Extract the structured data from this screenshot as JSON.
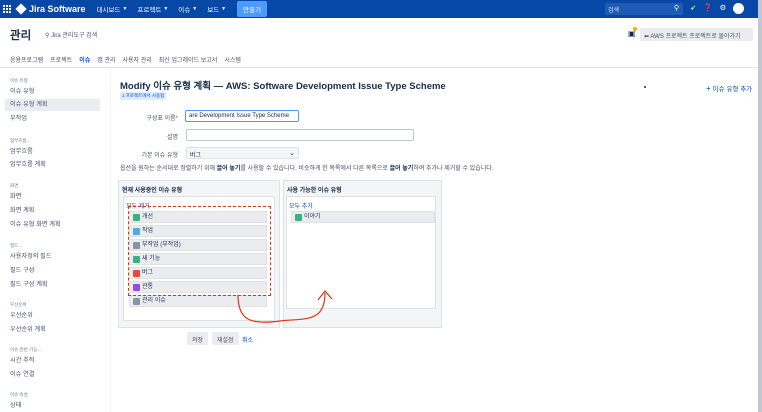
{
  "topnav": {
    "logo_text": "Jira Software",
    "items": [
      "대시보드",
      "프로젝트",
      "이슈",
      "보드"
    ],
    "create_label": "만들기",
    "search_placeholder": "검색"
  },
  "admin": {
    "title": "관리",
    "search_label": "Jira 관리도구 검색",
    "back_to_project": "AWS 프로젝트 프로젝트로 돌아가기",
    "tabs": [
      "응용프로그램",
      "프로젝트",
      "이슈",
      "앱 관리",
      "사용자 관리",
      "최신 업그레이드 보고서",
      "시스템"
    ],
    "active_tab_index": 2
  },
  "sidebar": {
    "sections": [
      {
        "heading": "이슈 유형",
        "items": [
          "이슈 유형",
          "이슈 유형 계획",
          "부작업"
        ]
      },
      {
        "heading": "업무흐름...",
        "items": [
          "업무흐름",
          "업무흐름 계획"
        ]
      },
      {
        "heading": "화면",
        "items": [
          "화면",
          "화면 계획",
          "이슈 유형 화면 계획"
        ]
      },
      {
        "heading": "필드...",
        "items": [
          "사용자정의 필드",
          "필드 구성",
          "필드 구성 계획"
        ]
      },
      {
        "heading": "우선순위",
        "items": [
          "우선순위",
          "우선순위 계획"
        ]
      },
      {
        "heading": "이슈 관련 기능...",
        "items": [
          "시간 추적",
          "이슈 연결"
        ]
      },
      {
        "heading": "이슈 속성",
        "items": [
          "상태"
        ]
      }
    ],
    "selected": "이슈 유형 계획"
  },
  "main": {
    "title": "Modify 이슈 유형 계획 — AWS: Software Development Issue Type Scheme",
    "usage_badge": "1 프로젝트에서 사용됨",
    "add_issue_type": "이슈 유형 추가",
    "form": {
      "scheme_name_label": "구성표 이름",
      "scheme_name_value": "are Development Issue Type Scheme",
      "description_label": "설명",
      "description_value": "",
      "default_type_label": "기본 이슈 유형",
      "default_type_value": "버그"
    },
    "instruction_parts": [
      "옵션을 원하는 순서대로 정렬하기 위해 ",
      "끌어 놓기",
      "를 사용할 수 있습니다. 비슷하게 한 목록에서 다른 목록으로 ",
      "끌어 놓기",
      "하여 추가나 제거할 수 있습니다."
    ],
    "current": {
      "title": "현재 사용중인 이슈 유형",
      "remove_all": "모두 제거",
      "types": [
        {
          "label": "개선",
          "color": "#36b37e",
          "icon": "improvement-icon"
        },
        {
          "label": "작업",
          "color": "#4bade8",
          "icon": "task-icon"
        },
        {
          "label": "부작업 (부작업)",
          "color": "#8993a4",
          "icon": "subtask-icon"
        },
        {
          "label": "새 기능",
          "color": "#36b37e",
          "icon": "new-feature-icon"
        },
        {
          "label": "버그",
          "color": "#e5493a",
          "icon": "bug-icon"
        },
        {
          "label": "관통",
          "color": "#904ee2",
          "icon": "epic-icon"
        },
        {
          "label": "관리 이슈",
          "color": "#8993a4",
          "icon": "admin-issue-icon"
        }
      ]
    },
    "available": {
      "title": "사용 가능한 이슈 유형",
      "add_all": "모두 추가",
      "types": [
        {
          "label": "이야기",
          "color": "#36b37e",
          "icon": "story-icon"
        }
      ]
    },
    "buttons": {
      "save": "저장",
      "reset": "재설정",
      "cancel": "취소"
    },
    "annotation_color": "#de350b"
  }
}
